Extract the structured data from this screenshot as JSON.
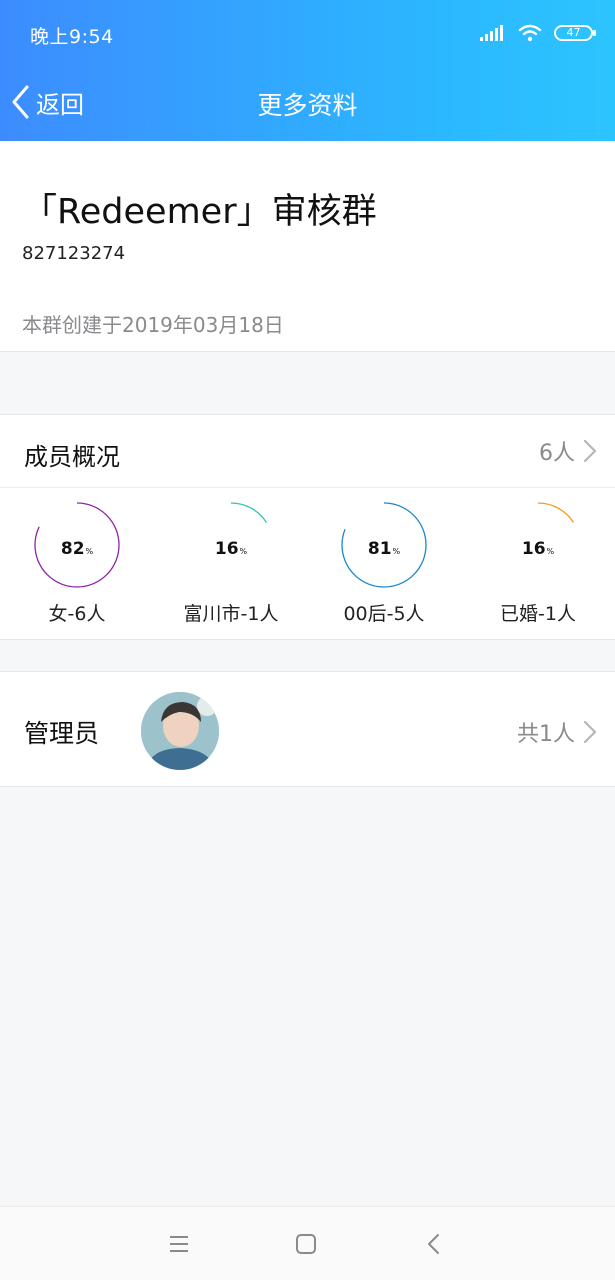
{
  "status_bar": {
    "time": "晚上9:54",
    "battery": "47",
    "icons": [
      "signal-icon",
      "wifi-icon",
      "battery-icon"
    ]
  },
  "nav": {
    "back_label": "返回",
    "title": "更多资料"
  },
  "group": {
    "name": "「Redeemer」审核群",
    "id": "827123274",
    "created": "本群创建于2019年03月18日"
  },
  "members": {
    "title": "成员概况",
    "count": "6人",
    "stats": [
      {
        "value": "82",
        "unit": "%",
        "label": "女-6人",
        "fraction": 0.82,
        "color": "#8e24aa"
      },
      {
        "value": "16",
        "unit": "%",
        "label": "富川市-1人",
        "fraction": 0.16,
        "color": "#26c6b0"
      },
      {
        "value": "81",
        "unit": "%",
        "label": "00后-5人",
        "fraction": 0.81,
        "color": "#1e88c8"
      },
      {
        "value": "16",
        "unit": "%",
        "label": "已婚-1人",
        "fraction": 0.16,
        "color": "#f29a1e"
      }
    ]
  },
  "admin": {
    "title": "管理员",
    "count": "共1人"
  },
  "system_nav": {
    "icons": [
      "menu-icon",
      "home-icon",
      "back-icon"
    ]
  },
  "colors": {
    "header_start": "#3d8cff",
    "header_end": "#2cc4ff",
    "background": "#f6f7f9"
  }
}
